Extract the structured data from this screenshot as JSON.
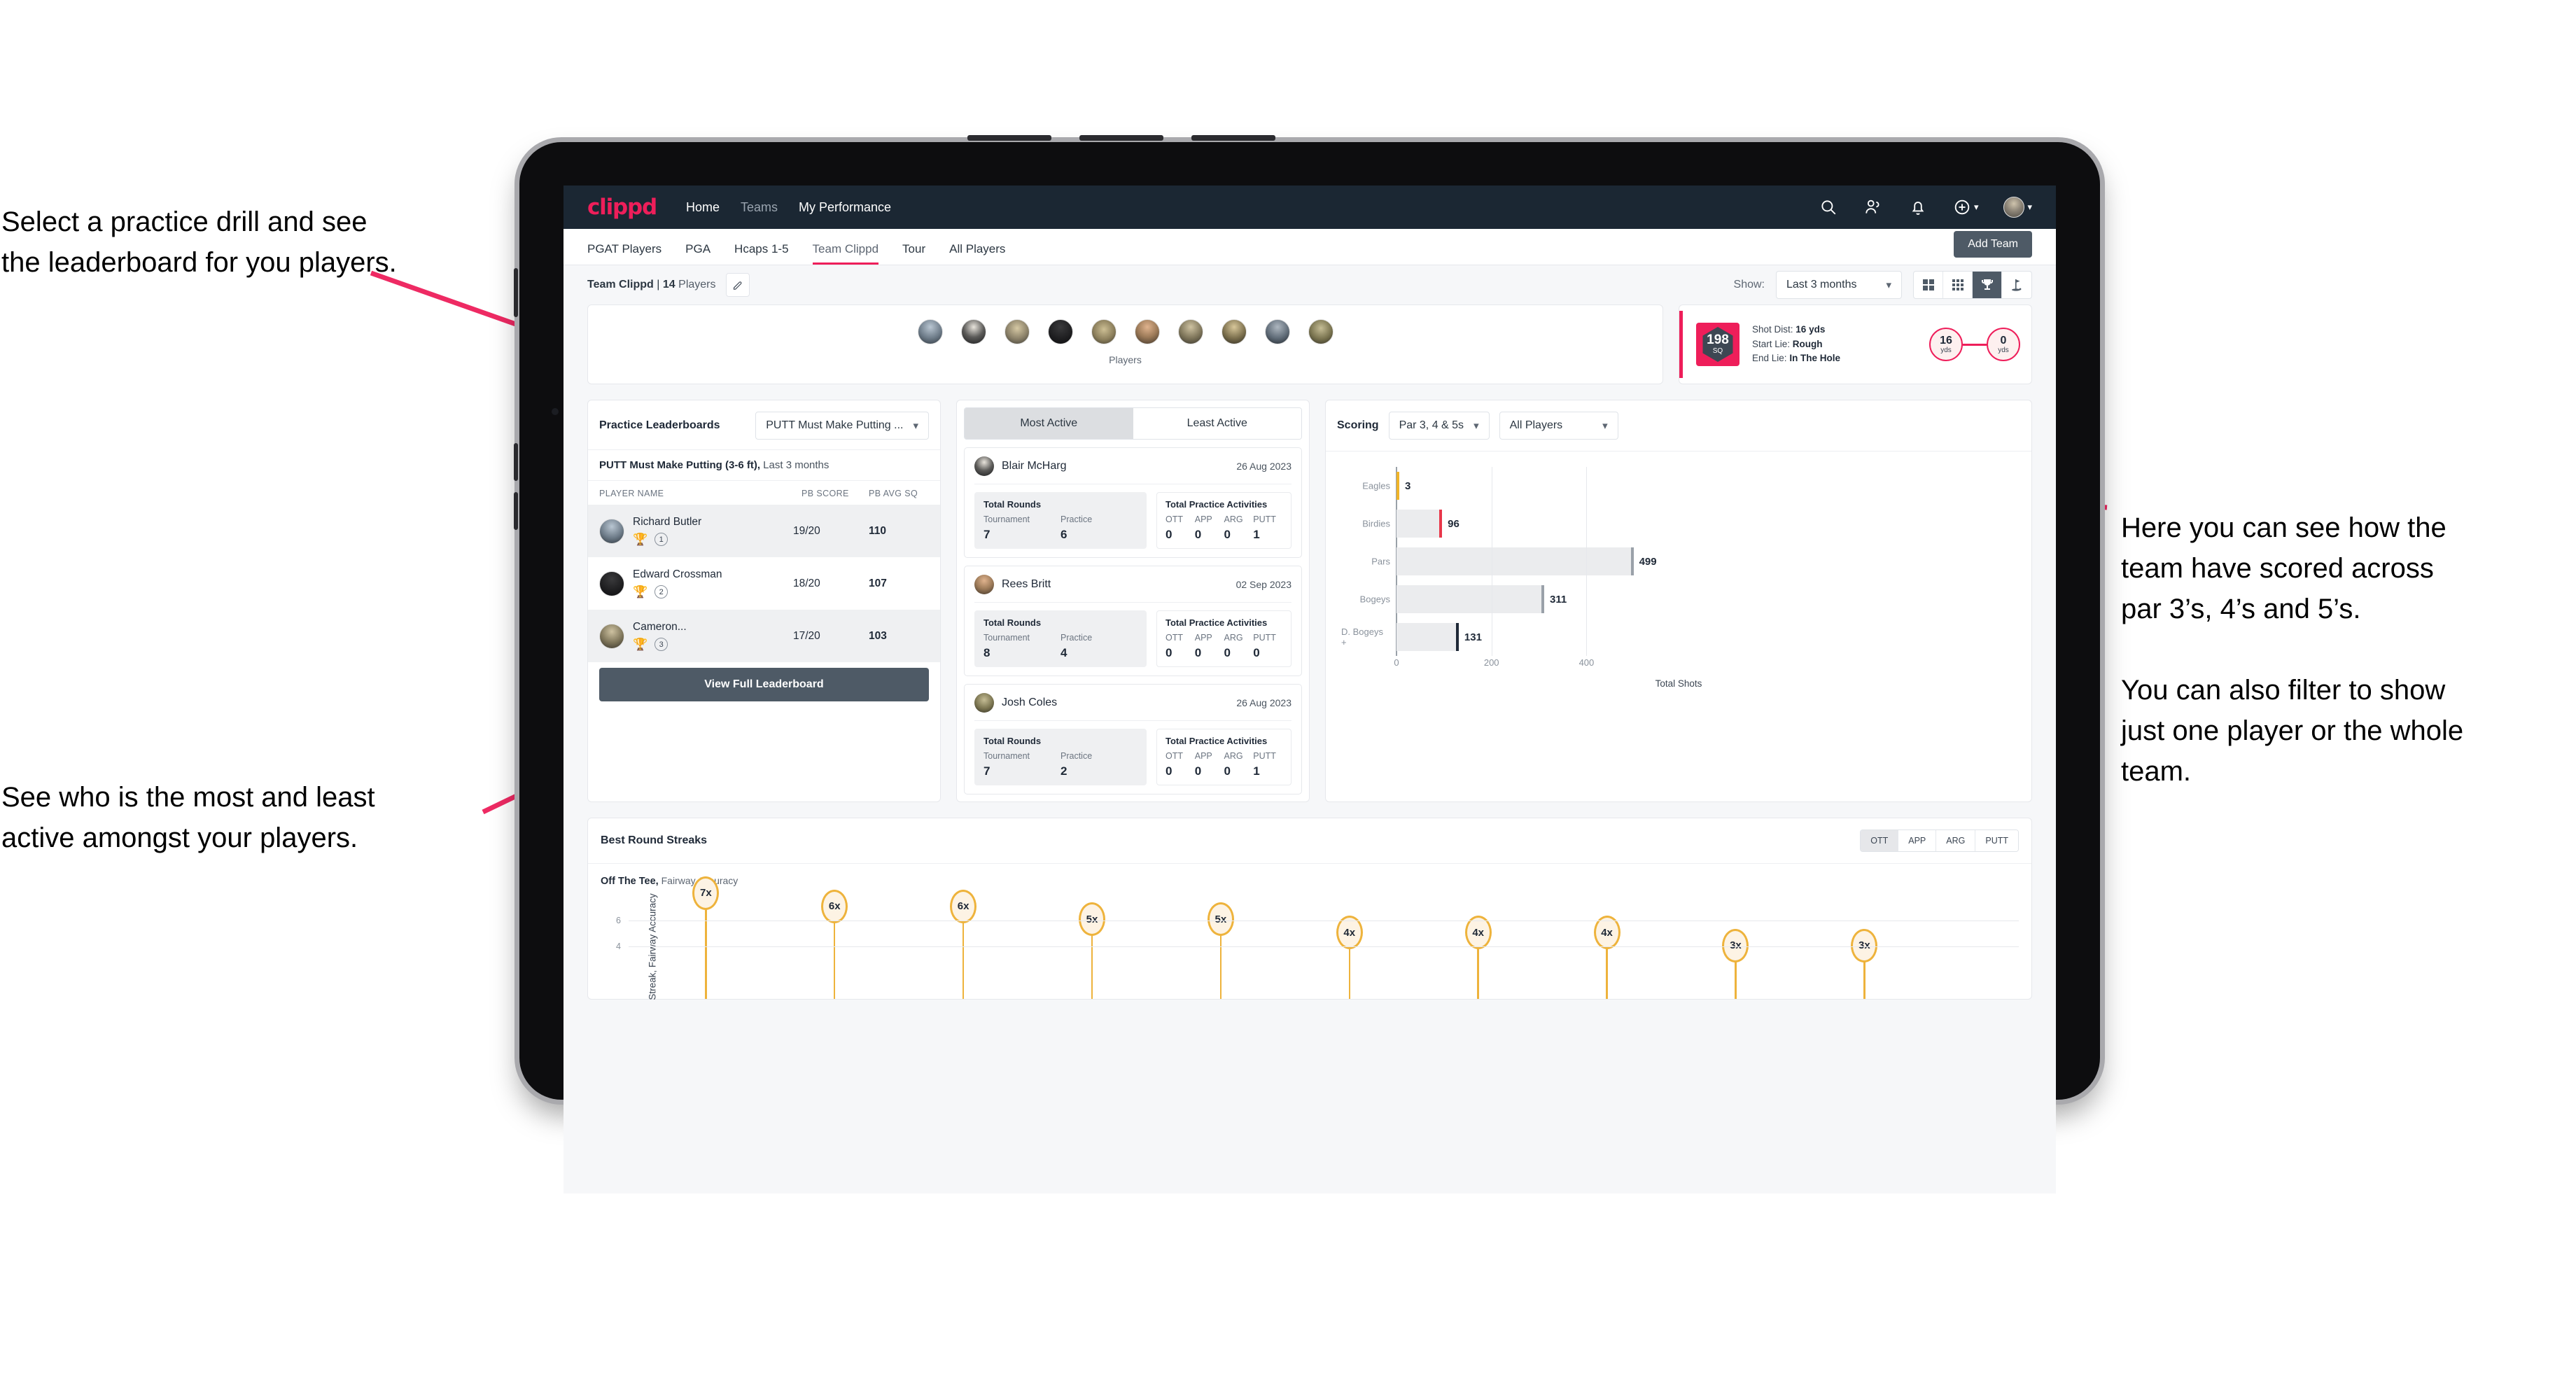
{
  "annotations": {
    "left_top": "Select a practice drill and see\nthe leaderboard for you players.",
    "left_bottom": "See who is the most and least\nactive amongst your players.",
    "right": "Here you can see how the\nteam have scored across\npar 3’s, 4’s and 5’s.\n\nYou can also filter to show\njust one player or the whole\nteam."
  },
  "colors": {
    "brand_pink": "#ee1e5a",
    "navy": "#1b2733",
    "slate": "#4e5a66",
    "amber": "#eeb33c"
  },
  "navbar": {
    "logo": "clippd",
    "links": [
      {
        "label": "Home",
        "active": true
      },
      {
        "label": "Teams",
        "active": false
      },
      {
        "label": "My Performance",
        "active": true
      }
    ],
    "icons": [
      "search-icon",
      "people-icon",
      "bell-icon",
      "plus-circle-icon",
      "avatar"
    ]
  },
  "tabs": {
    "items": [
      {
        "label": "PGAT Players",
        "active": false
      },
      {
        "label": "PGA",
        "active": false
      },
      {
        "label": "Hcaps 1-5",
        "active": false
      },
      {
        "label": "Team Clippd",
        "active": true
      },
      {
        "label": "Tour",
        "active": false
      },
      {
        "label": "All Players",
        "active": false
      }
    ],
    "add_team_label": "Add Team"
  },
  "subbar": {
    "team_name": "Team Clippd",
    "separator": "|",
    "player_count": "14",
    "players_word": "Players",
    "edit_icon": "pencil-icon",
    "show_label": "Show:",
    "range_value": "Last 3 months",
    "view_toggles": [
      {
        "icon": "grid-large-icon",
        "active": false
      },
      {
        "icon": "grid-small-icon",
        "active": false
      },
      {
        "icon": "trophy-icon",
        "active": true
      },
      {
        "icon": "golf-flag-icon",
        "active": false
      }
    ]
  },
  "players_strip": {
    "caption": "Players",
    "avatar_count": 10
  },
  "shot_card": {
    "sq_value": "198",
    "sq_label": "SQ",
    "lines": [
      {
        "label": "Shot Dist:",
        "value": "16 yds"
      },
      {
        "label": "Start Lie:",
        "value": "Rough"
      },
      {
        "label": "End Lie:",
        "value": "In The Hole"
      }
    ],
    "start_dist": {
      "value": "16",
      "unit": "yds"
    },
    "end_dist": {
      "value": "0",
      "unit": "yds"
    }
  },
  "leaderboard": {
    "title": "Practice Leaderboards",
    "drill_select": "PUTT Must Make Putting ...",
    "subtitle_bold": "PUTT Must Make Putting (3-6 ft),",
    "subtitle_muted": "Last 3 months",
    "columns": [
      "PLAYER NAME",
      "PB SCORE",
      "PB AVG SQ"
    ],
    "rows": [
      {
        "name": "Richard Butler",
        "trophy": "gold",
        "rank": "1",
        "score": "19/20",
        "sq": "110"
      },
      {
        "name": "Edward Crossman",
        "trophy": "silver",
        "rank": "2",
        "score": "18/20",
        "sq": "107"
      },
      {
        "name": "Cameron...",
        "trophy": "bronze",
        "rank": "3",
        "score": "17/20",
        "sq": "103"
      }
    ],
    "button_label": "View Full Leaderboard"
  },
  "activity": {
    "tabs": [
      {
        "label": "Most Active",
        "active": true
      },
      {
        "label": "Least Active",
        "active": false
      }
    ],
    "rounds_title": "Total Rounds",
    "rounds_keys": [
      "Tournament",
      "Practice"
    ],
    "practice_title": "Total Practice Activities",
    "practice_keys": [
      "OTT",
      "APP",
      "ARG",
      "PUTT"
    ],
    "items": [
      {
        "name": "Blair McHarg",
        "date": "26 Aug 2023",
        "tournament": "7",
        "practice": "6",
        "ott": "0",
        "app": "0",
        "arg": "0",
        "putt": "1"
      },
      {
        "name": "Rees Britt",
        "date": "02 Sep 2023",
        "tournament": "8",
        "practice": "4",
        "ott": "0",
        "app": "0",
        "arg": "0",
        "putt": "0"
      },
      {
        "name": "Josh Coles",
        "date": "26 Aug 2023",
        "tournament": "7",
        "practice": "2",
        "ott": "0",
        "app": "0",
        "arg": "0",
        "putt": "1"
      }
    ]
  },
  "scoring": {
    "title": "Scoring",
    "par_select": "Par 3, 4 & 5s",
    "player_select": "All Players"
  },
  "streaks": {
    "title": "Best Round Streaks",
    "segments": [
      {
        "label": "OTT",
        "active": true
      },
      {
        "label": "APP",
        "active": false
      },
      {
        "label": "ARG",
        "active": false
      },
      {
        "label": "PUTT",
        "active": false
      }
    ],
    "sub_bold": "Off The Tee,",
    "sub_muted": "Fairway Accuracy"
  },
  "chart_data": [
    {
      "type": "bar",
      "orientation": "horizontal",
      "title": "Scoring",
      "categories": [
        "Eagles",
        "Birdies",
        "Pars",
        "Bogeys",
        "D. Bogeys +"
      ],
      "values": [
        3,
        96,
        499,
        311,
        131
      ],
      "cap_colors": [
        "#f0b429",
        "#e8374a",
        "#9aa1a9",
        "#9aa1a9",
        "#1f2937"
      ],
      "xlabel": "Total Shots",
      "ylabel": "",
      "xlim": [
        0,
        560
      ],
      "xticks": [
        0,
        200,
        400
      ],
      "grid": true,
      "legend": "none"
    },
    {
      "type": "scatter",
      "title": "Best Round Streaks",
      "subtitle": "Off The Tee, Fairway Accuracy",
      "ylabel": "Streak, Fairway Accuracy",
      "xlabel": "",
      "ylim": [
        0,
        8
      ],
      "yticks": [
        4,
        6
      ],
      "labels": [
        "7x",
        "6x",
        "6x",
        "5x",
        "5x",
        "4x",
        "4x",
        "4x",
        "3x",
        "3x"
      ],
      "values": [
        7,
        6,
        6,
        5,
        5,
        4,
        4,
        4,
        3,
        3
      ],
      "grid": true
    }
  ]
}
